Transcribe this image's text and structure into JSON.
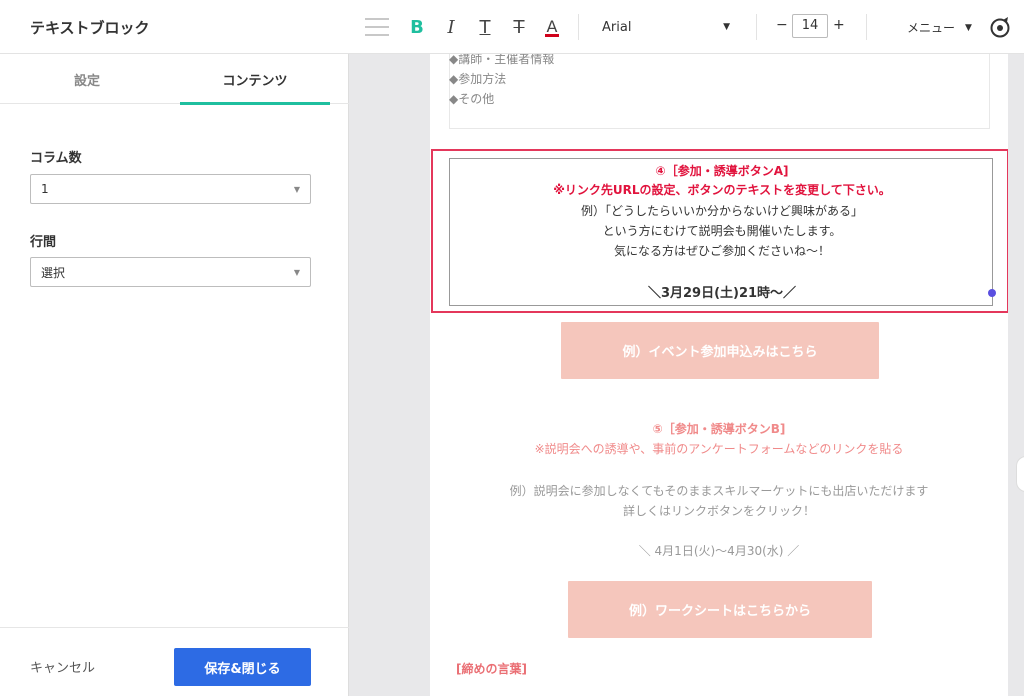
{
  "header": {
    "title": "テキストブロック",
    "format": {
      "bold": "B",
      "italic": "I",
      "underline": "T",
      "strike": "T",
      "color": "A"
    },
    "font": "Arial",
    "font_size": "14",
    "minus": "−",
    "plus": "+",
    "menu_label": "メニュー"
  },
  "sidebar": {
    "tabs": [
      "設定",
      "コンテンツ"
    ],
    "columns_label": "コラム数",
    "columns_value": "1",
    "line_height_label": "行間",
    "line_height_value": "選択",
    "cancel": "キャンセル",
    "save": "保存&閉じる"
  },
  "canvas": {
    "prev_lines": [
      "◆講師・主催者情報",
      "◆参加方法",
      "◆その他"
    ],
    "selected": {
      "heading": "④［参加・誘導ボタンA]",
      "note": "※リンク先URLの設定、ボタンのテキストを変更して下さい。",
      "line1": "例）「どうしたらいいか分からないけど興味がある」",
      "line2": "という方にむけて説明会も開催いたします。",
      "line3": "気になる方はぜひご参加くださいね〜！",
      "date": "＼3月29日(土)21時〜／"
    },
    "button_a": "例）イベント参加申込みはこちら",
    "section5": {
      "heading": "⑤［参加・誘導ボタンB]",
      "note": "※説明会への誘導や、事前のアンケートフォームなどのリンクを貼る",
      "line1": "例）説明会に参加しなくてもそのままスキルマーケットにも出店いただけます",
      "line2": "詳しくはリンクボタンをクリック！",
      "date": "＼ 4月1日(火)〜4月30(水) ／"
    },
    "button_b": "例）ワークシートはこちらから",
    "closing": "[締めの言葉]"
  }
}
